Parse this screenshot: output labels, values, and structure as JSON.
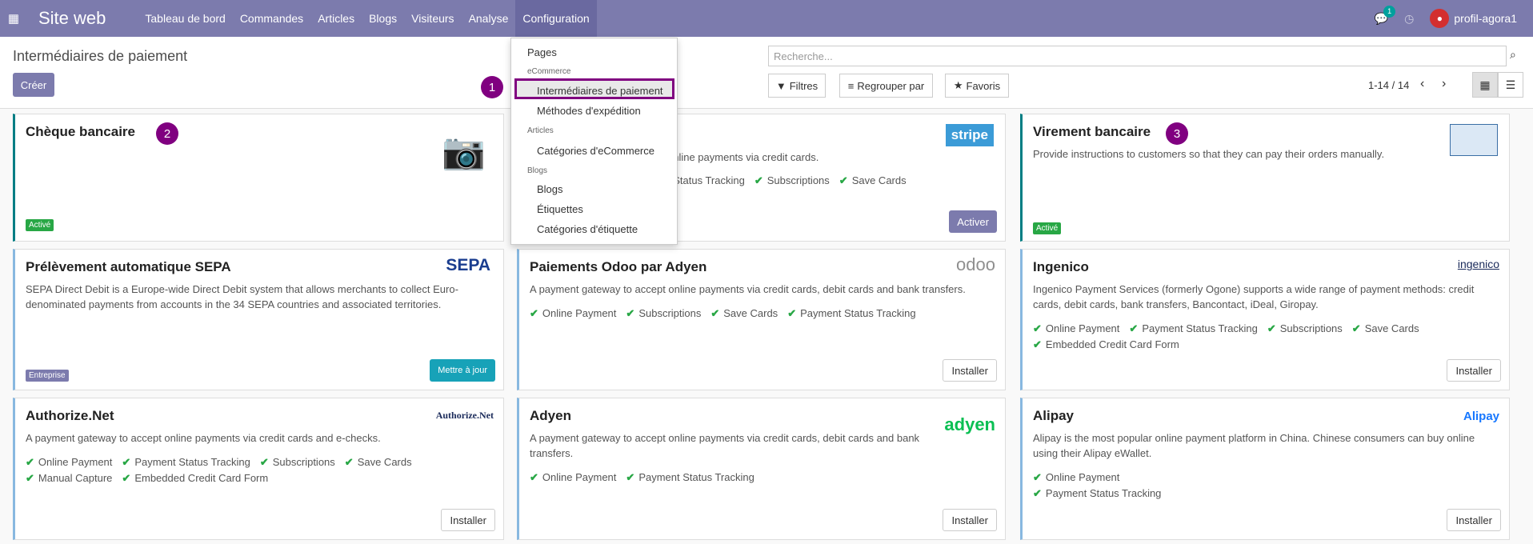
{
  "topbar": {
    "apps_icon": "grid-icon",
    "title": "Site web",
    "menu": [
      "Tableau de bord",
      "Commandes",
      "Articles",
      "Blogs",
      "Visiteurs",
      "Analyse",
      "Configuration"
    ],
    "chat_count": "1",
    "user": "profil-agora1"
  },
  "control": {
    "breadcrumb": "Intermédiaires de paiement",
    "create": "Créer",
    "search_placeholder": "Recherche...",
    "filters": "Filtres",
    "group_by": "Regrouper par",
    "favorites": "Favoris",
    "pager": "1-14 / 14"
  },
  "dropdown": {
    "pages": "Pages",
    "h_ecommerce": "eCommerce",
    "intermediaires": "Intermédiaires de paiement",
    "methodes": "Méthodes d'expédition",
    "h_articles": "Articles",
    "categories_ecom": "Catégories d'eCommerce",
    "h_blogs": "Blogs",
    "blogs": "Blogs",
    "etiquettes": "Étiquettes",
    "categories_etiq": "Catégories d'étiquette"
  },
  "annotations": {
    "n1": "1",
    "n2": "2",
    "n3": "3"
  },
  "cards": {
    "cheque": {
      "title": "Chèque bancaire",
      "tag": "Activé"
    },
    "stripe": {
      "logo": "stripe",
      "desc": "online payments via credit cards.",
      "features": [
        "t Status Tracking",
        "Subscriptions",
        "Save Cards"
      ],
      "button": "Activer"
    },
    "virement": {
      "title": "Virement bancaire",
      "desc": "Provide instructions to customers so that they can pay their orders manually.",
      "tag": "Activé"
    },
    "sepa": {
      "title": "Prélèvement automatique SEPA",
      "logo": "SEPA",
      "desc1": "SEPA Direct Debit is a Europe-wide Direct Debit system that allows merchants to collect Euro-",
      "desc2": "denominated payments from accounts in the 34 SEPA countries and associated territories.",
      "tag": "Entreprise",
      "button": "Mettre à jour"
    },
    "odoo": {
      "title": "Paiements Odoo par Adyen",
      "logo": "odoo",
      "desc": "A payment gateway to accept online payments via credit cards, debit cards and bank transfers.",
      "features": [
        "Online Payment",
        "Subscriptions",
        "Save Cards",
        "Payment Status Tracking"
      ],
      "button": "Installer"
    },
    "ingenico": {
      "title": "Ingenico",
      "logo": "ingenico",
      "desc1": "Ingenico Payment Services (formerly Ogone) supports a wide range of payment methods: credit",
      "desc2": "cards, debit cards, bank transfers, Bancontact, iDeal, Giropay.",
      "features": [
        "Online Payment",
        "Payment Status Tracking",
        "Subscriptions",
        "Save Cards",
        "Embedded Credit Card Form"
      ],
      "button": "Installer"
    },
    "authorize": {
      "title": "Authorize.Net",
      "logo": "Authorize.Net",
      "desc": "A payment gateway to accept online payments via credit cards and e-checks.",
      "features": [
        "Online Payment",
        "Payment Status Tracking",
        "Subscriptions",
        "Save Cards",
        "Manual Capture",
        "Embedded Credit Card Form"
      ],
      "button": "Installer"
    },
    "adyen": {
      "title": "Adyen",
      "logo": "adyen",
      "desc1": "A payment gateway to accept online payments via credit cards, debit cards and bank",
      "desc2": "transfers.",
      "features": [
        "Online Payment",
        "Payment Status Tracking"
      ],
      "button": "Installer"
    },
    "alipay": {
      "title": "Alipay",
      "logo": "Alipay",
      "desc1": "Alipay is the most popular online payment platform in China. Chinese consumers can buy online",
      "desc2": "using their Alipay eWallet.",
      "features": [
        "Online Payment",
        "Payment Status Tracking"
      ],
      "button": "Installer"
    }
  }
}
